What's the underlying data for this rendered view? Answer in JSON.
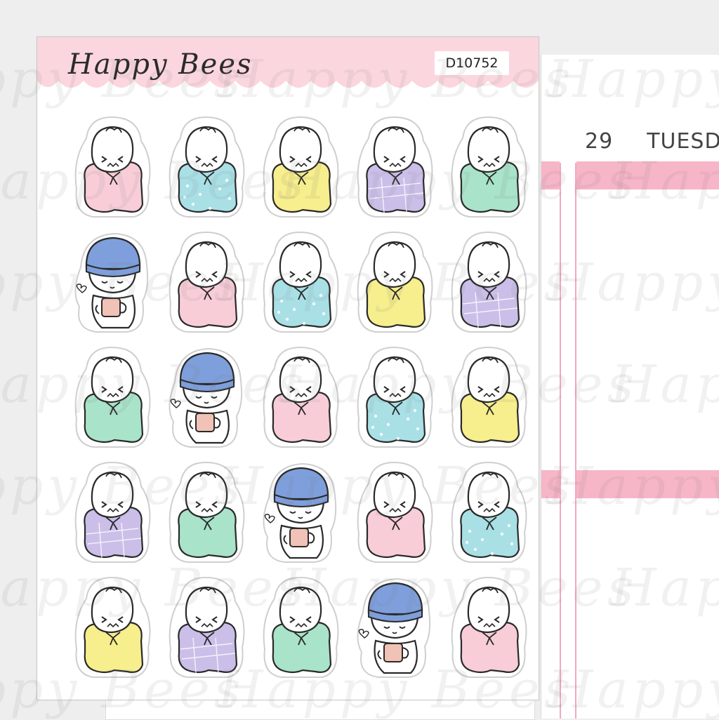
{
  "sheet": {
    "brand": "Happy Bees",
    "code": "D10752",
    "scallop_color": "#fbd6df"
  },
  "planner": {
    "date_number": "29",
    "date_day": "TUESD",
    "accent_color": "#f7b6c7"
  },
  "watermark_text": "Happy Bees",
  "stickers": [
    {
      "kind": "blanket",
      "color": "pink"
    },
    {
      "kind": "blanket",
      "color": "blue-dots"
    },
    {
      "kind": "blanket",
      "color": "yellow"
    },
    {
      "kind": "blanket",
      "color": "purple-plaid"
    },
    {
      "kind": "blanket",
      "color": "mint"
    },
    {
      "kind": "beanie-mug",
      "color": "blue-hat"
    },
    {
      "kind": "blanket",
      "color": "pink"
    },
    {
      "kind": "blanket",
      "color": "blue-dots"
    },
    {
      "kind": "blanket",
      "color": "yellow"
    },
    {
      "kind": "blanket",
      "color": "purple-plaid"
    },
    {
      "kind": "blanket",
      "color": "mint"
    },
    {
      "kind": "beanie-mug",
      "color": "blue-hat"
    },
    {
      "kind": "blanket",
      "color": "pink"
    },
    {
      "kind": "blanket",
      "color": "blue-dots"
    },
    {
      "kind": "blanket",
      "color": "yellow"
    },
    {
      "kind": "blanket",
      "color": "purple-plaid"
    },
    {
      "kind": "blanket",
      "color": "mint"
    },
    {
      "kind": "beanie-mug",
      "color": "blue-hat"
    },
    {
      "kind": "blanket",
      "color": "pink"
    },
    {
      "kind": "blanket",
      "color": "blue-dots"
    },
    {
      "kind": "blanket",
      "color": "yellow"
    },
    {
      "kind": "blanket",
      "color": "purple-plaid"
    },
    {
      "kind": "blanket",
      "color": "mint"
    },
    {
      "kind": "beanie-mug",
      "color": "blue-hat"
    },
    {
      "kind": "blanket",
      "color": "pink"
    }
  ],
  "palette": {
    "pink": "#f8cdd8",
    "blue-dots": "#a9e0e6",
    "yellow": "#f7ee8d",
    "purple-plaid": "#cbbfe9",
    "mint": "#a9e3c9",
    "blue-hat": "#7e9fdc",
    "mug": "#f1c2b6"
  }
}
